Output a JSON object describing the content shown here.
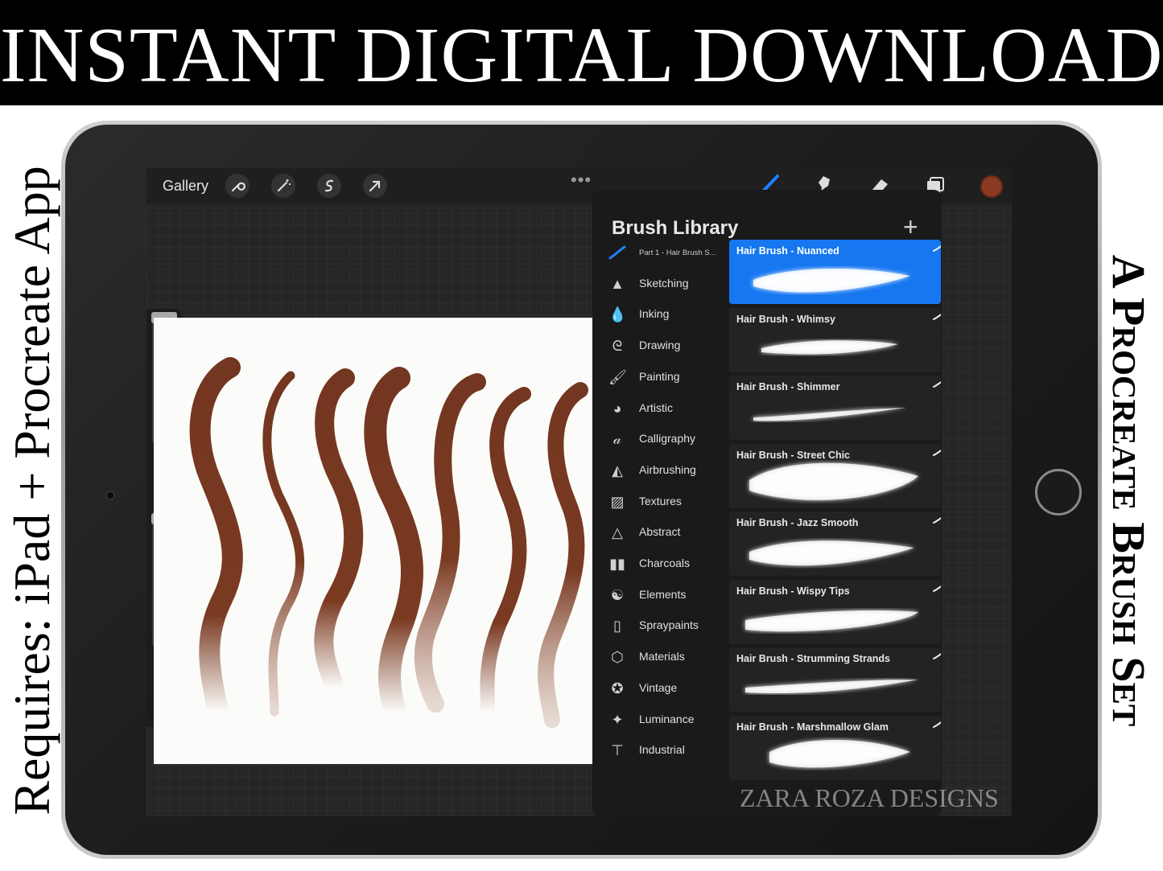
{
  "banner": {
    "title": "INSTANT DIGITAL DOWNLOAD"
  },
  "side_left": {
    "text": "Requires: iPad + Procreate App"
  },
  "side_right": {
    "text": "A Procreate Brush Set"
  },
  "toolbar": {
    "gallery_label": "Gallery",
    "left_tools": [
      "wrench-icon",
      "magic-wand-icon",
      "selection-icon",
      "transform-arrow-icon"
    ],
    "right_tools": [
      "brush-icon",
      "smudge-icon",
      "eraser-icon",
      "layers-icon"
    ],
    "menu_dots": "•••",
    "current_color": "#8b3a22"
  },
  "brush_library": {
    "title": "Brush Library",
    "add_symbol": "+",
    "categories": [
      {
        "label": "Part 1 - Hair Brush S...",
        "icon": "feather-icon"
      },
      {
        "label": "Sketching",
        "icon": "pencil-tip-icon"
      },
      {
        "label": "Inking",
        "icon": "ink-drop-icon"
      },
      {
        "label": "Drawing",
        "icon": "swirl-icon"
      },
      {
        "label": "Painting",
        "icon": "paint-brush-icon"
      },
      {
        "label": "Artistic",
        "icon": "palette-icon"
      },
      {
        "label": "Calligraphy",
        "icon": "calligraphy-a-icon"
      },
      {
        "label": "Airbrushing",
        "icon": "airbrush-icon"
      },
      {
        "label": "Textures",
        "icon": "texture-icon"
      },
      {
        "label": "Abstract",
        "icon": "triangle-icon"
      },
      {
        "label": "Charcoals",
        "icon": "charcoal-bars-icon"
      },
      {
        "label": "Elements",
        "icon": "yin-yang-icon"
      },
      {
        "label": "Spraypaints",
        "icon": "spray-can-icon"
      },
      {
        "label": "Materials",
        "icon": "cube-icon"
      },
      {
        "label": "Vintage",
        "icon": "star-circle-icon"
      },
      {
        "label": "Luminance",
        "icon": "sparkle-icon"
      },
      {
        "label": "Industrial",
        "icon": "anvil-icon"
      }
    ],
    "brushes": [
      {
        "name": "Hair Brush - Nuanced",
        "selected": true
      },
      {
        "name": "Hair Brush - Whimsy",
        "selected": false
      },
      {
        "name": "Hair Brush - Shimmer",
        "selected": false
      },
      {
        "name": "Hair Brush - Street Chic",
        "selected": false
      },
      {
        "name": "Hair Brush - Jazz Smooth",
        "selected": false
      },
      {
        "name": "Hair Brush - Wispy Tips",
        "selected": false
      },
      {
        "name": "Hair Brush - Strumming Strands",
        "selected": false
      },
      {
        "name": "Hair Brush - Marshmallow Glam",
        "selected": false
      }
    ]
  },
  "watermark": "ZARA ROZA DESIGNS",
  "colors": {
    "stroke": "#7a3a22",
    "selected": "#1677f0"
  }
}
